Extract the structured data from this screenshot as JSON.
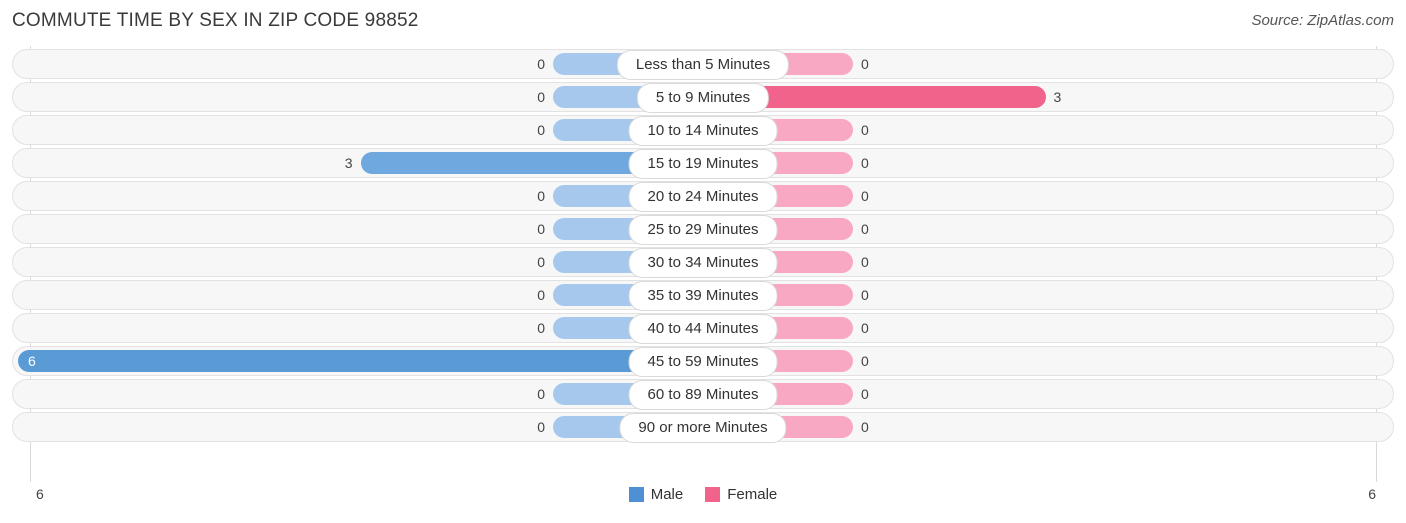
{
  "header": {
    "title": "COMMUTE TIME BY SEX IN ZIP CODE 98852",
    "source": "Source: ZipAtlas.com"
  },
  "legend": {
    "male_label": "Male",
    "female_label": "Female",
    "male_color": "#4f90d4",
    "female_color": "#f2638c"
  },
  "axis": {
    "left_label": "6",
    "right_label": "6",
    "max": 6
  },
  "colors": {
    "male_light": "#a6c8ec",
    "male_dark": "#6ea8de",
    "male_full": "#5a9bd5",
    "female_light": "#f9a8c4",
    "female_dark": "#f2638c",
    "track": "#f7f7f7",
    "track_border": "#e2e2e2",
    "gridline": "#d8d8d8"
  },
  "chart_data": {
    "type": "bar",
    "title": "COMMUTE TIME BY SEX IN ZIP CODE 98852",
    "subtitle": "Source: ZipAtlas.com",
    "orientation": "horizontal-diverging",
    "xlabel": "",
    "ylabel": "",
    "xlim": [
      6,
      6
    ],
    "grid": true,
    "legend_position": "bottom-center",
    "categories": [
      "Less than 5 Minutes",
      "5 to 9 Minutes",
      "10 to 14 Minutes",
      "15 to 19 Minutes",
      "20 to 24 Minutes",
      "25 to 29 Minutes",
      "30 to 34 Minutes",
      "35 to 39 Minutes",
      "40 to 44 Minutes",
      "45 to 59 Minutes",
      "60 to 89 Minutes",
      "90 or more Minutes"
    ],
    "series": [
      {
        "name": "Male",
        "color": "#4f90d4",
        "values": [
          0,
          0,
          0,
          3,
          0,
          0,
          0,
          0,
          0,
          6,
          0,
          0
        ]
      },
      {
        "name": "Female",
        "color": "#f2638c",
        "values": [
          0,
          3,
          0,
          0,
          0,
          0,
          0,
          0,
          0,
          0,
          0,
          0
        ]
      }
    ]
  },
  "rows": [
    {
      "label": "Less than 5 Minutes",
      "male": "0",
      "female": "0"
    },
    {
      "label": "5 to 9 Minutes",
      "male": "0",
      "female": "3"
    },
    {
      "label": "10 to 14 Minutes",
      "male": "0",
      "female": "0"
    },
    {
      "label": "15 to 19 Minutes",
      "male": "3",
      "female": "0"
    },
    {
      "label": "20 to 24 Minutes",
      "male": "0",
      "female": "0"
    },
    {
      "label": "25 to 29 Minutes",
      "male": "0",
      "female": "0"
    },
    {
      "label": "30 to 34 Minutes",
      "male": "0",
      "female": "0"
    },
    {
      "label": "35 to 39 Minutes",
      "male": "0",
      "female": "0"
    },
    {
      "label": "40 to 44 Minutes",
      "male": "0",
      "female": "0"
    },
    {
      "label": "45 to 59 Minutes",
      "male": "6",
      "female": "0"
    },
    {
      "label": "60 to 89 Minutes",
      "male": "0",
      "female": "0"
    },
    {
      "label": "90 or more Minutes",
      "male": "0",
      "female": "0"
    }
  ]
}
